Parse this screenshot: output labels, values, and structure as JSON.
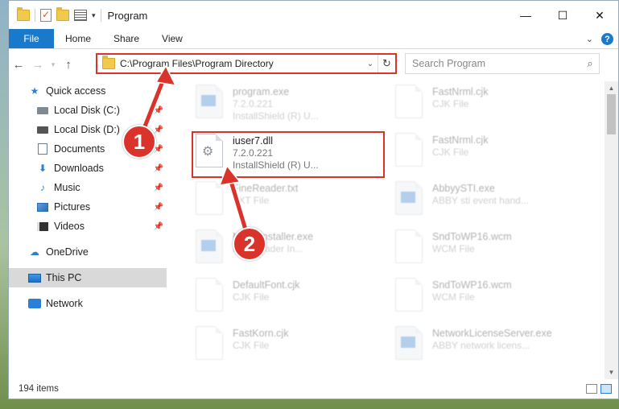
{
  "window": {
    "title": "Program",
    "min_icon": "minimize-icon",
    "max_icon": "maximize-icon",
    "close_icon": "close-icon"
  },
  "ribbon": {
    "tabs": [
      "File",
      "Home",
      "Share",
      "View"
    ],
    "help": "?"
  },
  "address": {
    "path": "C:\\Program Files\\Program Directory",
    "search_placeholder": "Search Program"
  },
  "sidebar": {
    "items": [
      {
        "label": "Quick access",
        "icon": "star-icon"
      },
      {
        "label": "Local Disk (C:)",
        "icon": "disk-icon"
      },
      {
        "label": "Local Disk (D:)",
        "icon": "disk-icon"
      },
      {
        "label": "Documents",
        "icon": "documents-icon"
      },
      {
        "label": "Downloads",
        "icon": "downloads-icon"
      },
      {
        "label": "Music",
        "icon": "music-icon"
      },
      {
        "label": "Pictures",
        "icon": "pictures-icon"
      },
      {
        "label": "Videos",
        "icon": "videos-icon"
      },
      {
        "label": "OneDrive",
        "icon": "cloud-icon"
      },
      {
        "label": "This PC",
        "icon": "pc-icon"
      },
      {
        "label": "Network",
        "icon": "network-icon"
      }
    ]
  },
  "files": [
    {
      "name": "program.exe",
      "line2": "7.2.0.221",
      "line3": "InstallShield (R) U..."
    },
    {
      "name": "FastNrml.cjk",
      "line2": "CJK File",
      "line3": ""
    },
    {
      "name": "iuser7.dll",
      "line2": "7.2.0.221",
      "line3": "InstallShield (R) U..."
    },
    {
      "name": "FastNrml.cjk",
      "line2": "CJK File",
      "line3": ""
    },
    {
      "name": "FineReader.txt",
      "line2": "TXT File",
      "line3": ""
    },
    {
      "name": "AbbyySTI.exe",
      "line2": "ABBY sti event hand...",
      "line3": ""
    },
    {
      "name": "MsmsInstaller.exe",
      "line2": "Microreader In...",
      "line3": ""
    },
    {
      "name": "SndToWP16.wcm",
      "line2": "WCM File",
      "line3": ""
    },
    {
      "name": "DefaultFont.cjk",
      "line2": "CJK File",
      "line3": ""
    },
    {
      "name": "SndToWP16.wcm",
      "line2": "WCM File",
      "line3": ""
    },
    {
      "name": "FastKorn.cjk",
      "line2": "CJK File",
      "line3": ""
    },
    {
      "name": "NetworkLicenseServer.exe",
      "line2": "ABBY network licens...",
      "line3": ""
    }
  ],
  "status": {
    "item_count": "194 items"
  },
  "annotations": {
    "step1": "1",
    "step2": "2",
    "accent": "#d9332b"
  }
}
